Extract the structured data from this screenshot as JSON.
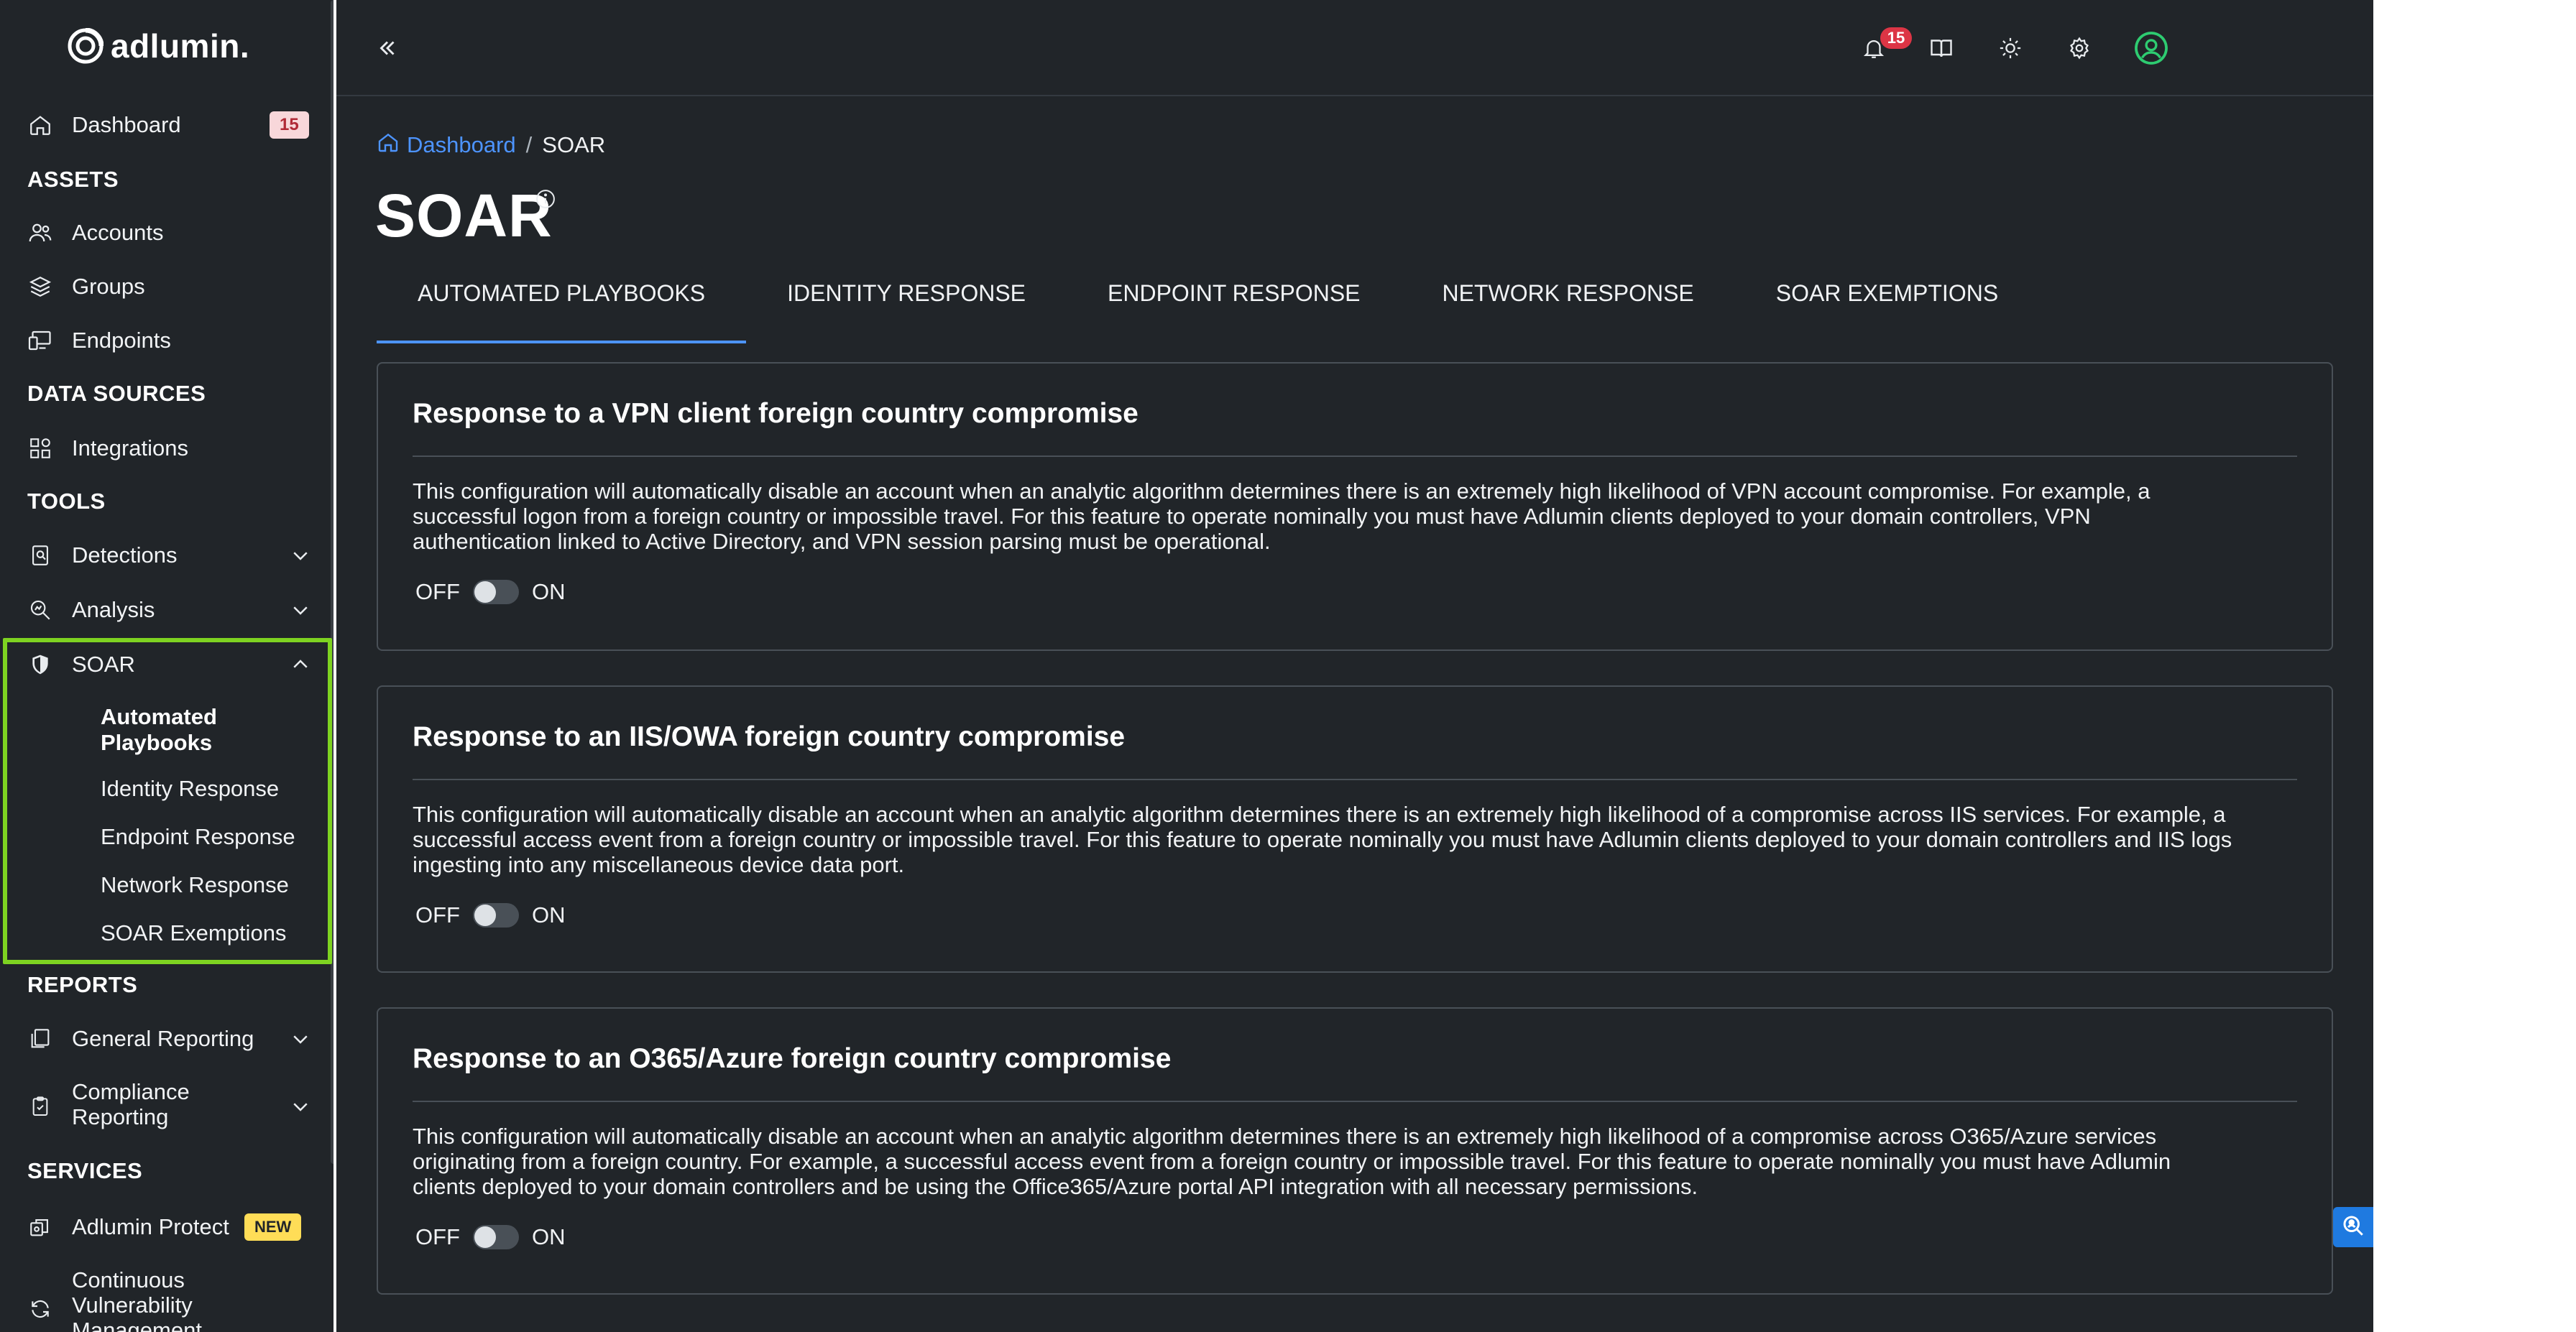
{
  "app": {
    "logo_text": "adlumin."
  },
  "sidebar": {
    "dashboard": {
      "label": "Dashboard",
      "badge": "15"
    },
    "sections": {
      "assets": "ASSETS",
      "data_sources": "DATA SOURCES",
      "tools": "TOOLS",
      "reports": "REPORTS",
      "services": "SERVICES"
    },
    "items": {
      "accounts": "Accounts",
      "groups": "Groups",
      "endpoints": "Endpoints",
      "integrations": "Integrations",
      "detections": "Detections",
      "analysis": "Analysis",
      "soar": "SOAR",
      "general_reporting": "General Reporting",
      "compliance_reporting_1": "Compliance",
      "compliance_reporting_2": "Reporting",
      "adlumin_protect": "Adlumin Protect",
      "adlumin_protect_badge": "NEW",
      "cvm_1": "Continuous",
      "cvm_2": "Vulnerability",
      "cvm_3": "Management"
    },
    "soar_sub": {
      "automated_playbooks_1": "Automated",
      "automated_playbooks_2": "Playbooks",
      "identity_response": "Identity Response",
      "endpoint_response": "Endpoint Response",
      "network_response": "Network Response",
      "soar_exemptions": "SOAR Exemptions"
    },
    "highlight_color": "#7ed321"
  },
  "topbar": {
    "notification_count": "15",
    "icons": [
      "collapse-sidebar-icon",
      "bell-icon",
      "book-icon",
      "sun-icon",
      "gear-icon",
      "user-avatar-icon"
    ]
  },
  "breadcrumb": {
    "home": "Dashboard",
    "separator": "/",
    "current": "SOAR"
  },
  "page": {
    "title": "SOAR"
  },
  "tabs": [
    {
      "label": "AUTOMATED PLAYBOOKS",
      "active": true
    },
    {
      "label": "IDENTITY RESPONSE",
      "active": false
    },
    {
      "label": "ENDPOINT RESPONSE",
      "active": false
    },
    {
      "label": "NETWORK RESPONSE",
      "active": false
    },
    {
      "label": "SOAR EXEMPTIONS",
      "active": false
    }
  ],
  "cards": [
    {
      "title": "Response to a VPN client foreign country compromise",
      "lines": [
        "This configuration will automatically disable an account when an analytic algorithm determines there is an extremely high likelihood of VPN account compromise. For example, a",
        "successful logon from a foreign country or impossible travel. For this feature to operate nominally you must have Adlumin clients deployed to your domain controllers, VPN",
        "authentication linked to Active Directory, and VPN session parsing must be operational."
      ],
      "toggle": {
        "off_label": "OFF",
        "on_label": "ON",
        "value": "OFF"
      }
    },
    {
      "title": "Response to an IIS/OWA foreign country compromise",
      "lines": [
        "This configuration will automatically disable an account when an analytic algorithm determines there is an extremely high likelihood of a compromise across IIS services. For example, a",
        "successful access event from a foreign country or impossible travel. For this feature to operate nominally you must have Adlumin clients deployed to your domain controllers and IIS logs",
        "ingesting into any miscellaneous device data port."
      ],
      "toggle": {
        "off_label": "OFF",
        "on_label": "ON",
        "value": "OFF"
      }
    },
    {
      "title": "Response to an O365/Azure foreign country compromise",
      "lines": [
        "This configuration will automatically disable an account when an analytic algorithm determines there is an extremely high likelihood of a compromise across O365/Azure services",
        "originating from a foreign country. For example, a successful access event from a foreign country or impossible travel. For this feature to operate nominally you must have Adlumin",
        "clients deployed to your domain controllers and be using the Office365/Azure portal API integration with all necessary permissions."
      ],
      "toggle": {
        "off_label": "OFF",
        "on_label": "ON",
        "value": "OFF"
      }
    }
  ]
}
